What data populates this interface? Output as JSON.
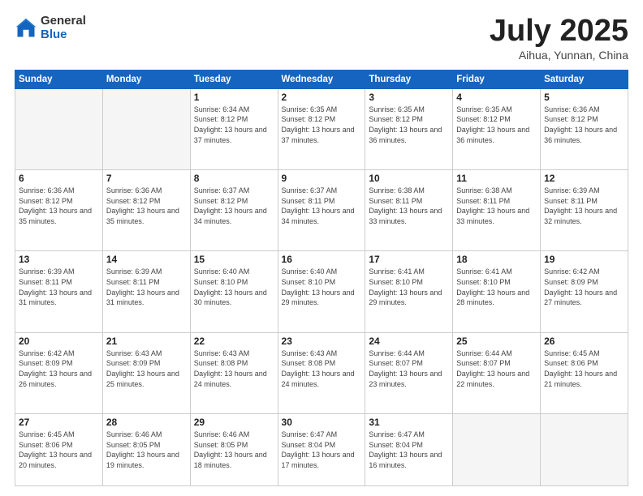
{
  "header": {
    "logo_general": "General",
    "logo_blue": "Blue",
    "title": "July 2025",
    "location": "Aihua, Yunnan, China"
  },
  "weekdays": [
    "Sunday",
    "Monday",
    "Tuesday",
    "Wednesday",
    "Thursday",
    "Friday",
    "Saturday"
  ],
  "weeks": [
    [
      {
        "day": "",
        "empty": true
      },
      {
        "day": "",
        "empty": true
      },
      {
        "day": "1",
        "sunrise": "Sunrise: 6:34 AM",
        "sunset": "Sunset: 8:12 PM",
        "daylight": "Daylight: 13 hours and 37 minutes."
      },
      {
        "day": "2",
        "sunrise": "Sunrise: 6:35 AM",
        "sunset": "Sunset: 8:12 PM",
        "daylight": "Daylight: 13 hours and 37 minutes."
      },
      {
        "day": "3",
        "sunrise": "Sunrise: 6:35 AM",
        "sunset": "Sunset: 8:12 PM",
        "daylight": "Daylight: 13 hours and 36 minutes."
      },
      {
        "day": "4",
        "sunrise": "Sunrise: 6:35 AM",
        "sunset": "Sunset: 8:12 PM",
        "daylight": "Daylight: 13 hours and 36 minutes."
      },
      {
        "day": "5",
        "sunrise": "Sunrise: 6:36 AM",
        "sunset": "Sunset: 8:12 PM",
        "daylight": "Daylight: 13 hours and 36 minutes."
      }
    ],
    [
      {
        "day": "6",
        "sunrise": "Sunrise: 6:36 AM",
        "sunset": "Sunset: 8:12 PM",
        "daylight": "Daylight: 13 hours and 35 minutes."
      },
      {
        "day": "7",
        "sunrise": "Sunrise: 6:36 AM",
        "sunset": "Sunset: 8:12 PM",
        "daylight": "Daylight: 13 hours and 35 minutes."
      },
      {
        "day": "8",
        "sunrise": "Sunrise: 6:37 AM",
        "sunset": "Sunset: 8:12 PM",
        "daylight": "Daylight: 13 hours and 34 minutes."
      },
      {
        "day": "9",
        "sunrise": "Sunrise: 6:37 AM",
        "sunset": "Sunset: 8:11 PM",
        "daylight": "Daylight: 13 hours and 34 minutes."
      },
      {
        "day": "10",
        "sunrise": "Sunrise: 6:38 AM",
        "sunset": "Sunset: 8:11 PM",
        "daylight": "Daylight: 13 hours and 33 minutes."
      },
      {
        "day": "11",
        "sunrise": "Sunrise: 6:38 AM",
        "sunset": "Sunset: 8:11 PM",
        "daylight": "Daylight: 13 hours and 33 minutes."
      },
      {
        "day": "12",
        "sunrise": "Sunrise: 6:39 AM",
        "sunset": "Sunset: 8:11 PM",
        "daylight": "Daylight: 13 hours and 32 minutes."
      }
    ],
    [
      {
        "day": "13",
        "sunrise": "Sunrise: 6:39 AM",
        "sunset": "Sunset: 8:11 PM",
        "daylight": "Daylight: 13 hours and 31 minutes."
      },
      {
        "day": "14",
        "sunrise": "Sunrise: 6:39 AM",
        "sunset": "Sunset: 8:11 PM",
        "daylight": "Daylight: 13 hours and 31 minutes."
      },
      {
        "day": "15",
        "sunrise": "Sunrise: 6:40 AM",
        "sunset": "Sunset: 8:10 PM",
        "daylight": "Daylight: 13 hours and 30 minutes."
      },
      {
        "day": "16",
        "sunrise": "Sunrise: 6:40 AM",
        "sunset": "Sunset: 8:10 PM",
        "daylight": "Daylight: 13 hours and 29 minutes."
      },
      {
        "day": "17",
        "sunrise": "Sunrise: 6:41 AM",
        "sunset": "Sunset: 8:10 PM",
        "daylight": "Daylight: 13 hours and 29 minutes."
      },
      {
        "day": "18",
        "sunrise": "Sunrise: 6:41 AM",
        "sunset": "Sunset: 8:10 PM",
        "daylight": "Daylight: 13 hours and 28 minutes."
      },
      {
        "day": "19",
        "sunrise": "Sunrise: 6:42 AM",
        "sunset": "Sunset: 8:09 PM",
        "daylight": "Daylight: 13 hours and 27 minutes."
      }
    ],
    [
      {
        "day": "20",
        "sunrise": "Sunrise: 6:42 AM",
        "sunset": "Sunset: 8:09 PM",
        "daylight": "Daylight: 13 hours and 26 minutes."
      },
      {
        "day": "21",
        "sunrise": "Sunrise: 6:43 AM",
        "sunset": "Sunset: 8:09 PM",
        "daylight": "Daylight: 13 hours and 25 minutes."
      },
      {
        "day": "22",
        "sunrise": "Sunrise: 6:43 AM",
        "sunset": "Sunset: 8:08 PM",
        "daylight": "Daylight: 13 hours and 24 minutes."
      },
      {
        "day": "23",
        "sunrise": "Sunrise: 6:43 AM",
        "sunset": "Sunset: 8:08 PM",
        "daylight": "Daylight: 13 hours and 24 minutes."
      },
      {
        "day": "24",
        "sunrise": "Sunrise: 6:44 AM",
        "sunset": "Sunset: 8:07 PM",
        "daylight": "Daylight: 13 hours and 23 minutes."
      },
      {
        "day": "25",
        "sunrise": "Sunrise: 6:44 AM",
        "sunset": "Sunset: 8:07 PM",
        "daylight": "Daylight: 13 hours and 22 minutes."
      },
      {
        "day": "26",
        "sunrise": "Sunrise: 6:45 AM",
        "sunset": "Sunset: 8:06 PM",
        "daylight": "Daylight: 13 hours and 21 minutes."
      }
    ],
    [
      {
        "day": "27",
        "sunrise": "Sunrise: 6:45 AM",
        "sunset": "Sunset: 8:06 PM",
        "daylight": "Daylight: 13 hours and 20 minutes."
      },
      {
        "day": "28",
        "sunrise": "Sunrise: 6:46 AM",
        "sunset": "Sunset: 8:05 PM",
        "daylight": "Daylight: 13 hours and 19 minutes."
      },
      {
        "day": "29",
        "sunrise": "Sunrise: 6:46 AM",
        "sunset": "Sunset: 8:05 PM",
        "daylight": "Daylight: 13 hours and 18 minutes."
      },
      {
        "day": "30",
        "sunrise": "Sunrise: 6:47 AM",
        "sunset": "Sunset: 8:04 PM",
        "daylight": "Daylight: 13 hours and 17 minutes."
      },
      {
        "day": "31",
        "sunrise": "Sunrise: 6:47 AM",
        "sunset": "Sunset: 8:04 PM",
        "daylight": "Daylight: 13 hours and 16 minutes."
      },
      {
        "day": "",
        "empty": true
      },
      {
        "day": "",
        "empty": true
      }
    ]
  ]
}
